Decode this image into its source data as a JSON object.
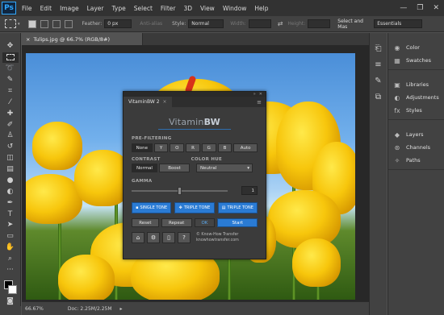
{
  "app": {
    "logo": "Ps",
    "menus": [
      "File",
      "Edit",
      "Image",
      "Layer",
      "Type",
      "Select",
      "Filter",
      "3D",
      "View",
      "Window",
      "Help"
    ]
  },
  "options": {
    "feather_label": "Feather:",
    "feather_value": "0 px",
    "antialias": "Anti-alias",
    "style_label": "Style:",
    "style_value": "Normal",
    "width_label": "Width:",
    "height_label": "Height:",
    "select_mask": "Select and Mas",
    "workspace": "Essentials"
  },
  "document": {
    "tab_title": "Tulips.jpg @ 66.7% (RGB/8#)",
    "zoom": "66.67%",
    "doc_info": "Doc: 2.25M/2.25M"
  },
  "right_panels": {
    "group1": [
      "Color",
      "Swatches"
    ],
    "group2": [
      "Libraries",
      "Adjustments",
      "Styles"
    ],
    "group3": [
      "Layers",
      "Channels",
      "Paths"
    ]
  },
  "vitamin": {
    "tab": "VitaminBW 2",
    "logo_a": "Vitamin",
    "logo_b": "BW",
    "pre_filtering": "PRE-FILTERING",
    "filters": [
      "None",
      "Y",
      "O",
      "R",
      "G",
      "B",
      "Auto"
    ],
    "contrast_label": "CONTRAST",
    "color_hue_label": "COLOR HUE",
    "contrast_normal": "Normal",
    "contrast_boost": "Boost",
    "hue_value": "Neutral",
    "gamma_label": "GAMMA",
    "gamma_value": "1",
    "gamma_level": 0.5,
    "single_tone": "SINGLE TONE",
    "triple_tone_1": "TRIPLE TONE",
    "triple_tone_2": "TRIPLE TONE",
    "reset": "Reset",
    "repeat": "Repeat",
    "ok": "OK",
    "start": "Start",
    "credit_line1": "© Know-How Transfer",
    "credit_line2": "knowhowtransfer.com"
  }
}
